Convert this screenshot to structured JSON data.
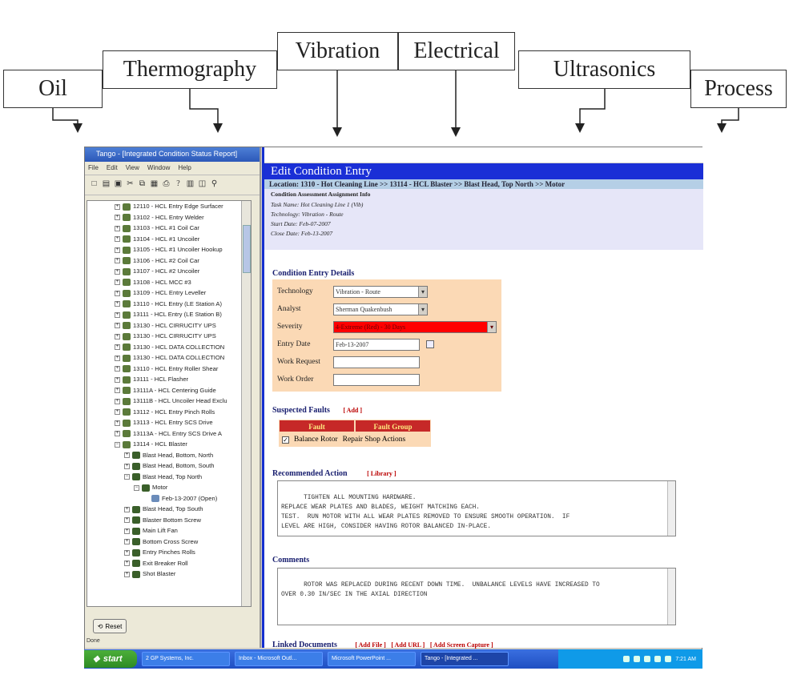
{
  "labels": {
    "oil": "Oil",
    "thermography": "Thermography",
    "vibration": "Vibration",
    "electrical": "Electrical",
    "ultrasonics": "Ultrasonics",
    "process": "Process"
  },
  "left_window": {
    "title": "Tango - [Integrated Condition Status Report]",
    "menu": [
      "File",
      "Edit",
      "View",
      "Window",
      "Help"
    ],
    "tree_items": [
      "12110 - HCL Entry Edge Surfacer",
      "13102 - HCL Entry Welder",
      "13103 - HCL #1 Coil Car",
      "13104 - HCL #1 Uncoiler",
      "13105 - HCL #1 Uncoiler Hookup",
      "13106 - HCL #2 Coil Car",
      "13107 - HCL #2 Uncoiler",
      "13108 - HCL MCC #3",
      "13109 - HCL Entry Leveller",
      "13110 - HCL Entry (LE Station A)",
      "13111 - HCL Entry (LE Station B)",
      "13130 - HCL CIRRUCITY UPS",
      "13130 - HCL CIRRUCITY UPS",
      "13130 - HCL DATA COLLECTION",
      "13130 - HCL DATA COLLECTION",
      "13110 - HCL Entry Roller Shear",
      "13111 - HCL Flasher",
      "13111A - HCL Centering Guide",
      "13111B - HCL Uncoiler Head Exclu",
      "13112 - HCL Entry Pinch Rolls",
      "13113 - HCL Entry SCS Drive",
      "13113A - HCL Entry SCS Drive A",
      "13114 - HCL Blaster",
      "Blast Head, Bottom, North",
      "Blast Head, Bottom, South",
      "Blast Head, Top North",
      "Motor",
      "Feb-13-2007 (Open)",
      "Blast Head, Top South",
      "Blaster Bottom Screw",
      "Main Lift Fan",
      "Bottom Cross Screw",
      "Entry Pinches Rolls",
      "Exit Breaker Roll",
      "Shot Blaster"
    ],
    "reset_label": "Reset",
    "status": "Done"
  },
  "edit": {
    "heading": "Edit Condition Entry",
    "location": "Location: 1310 - Hot Cleaning Line >> 13114 - HCL Blaster >> Blast Head, Top North >> Motor",
    "assignment_title": "Condition Assessment Assignment Info",
    "assignment_rows": [
      "Task Name: Hot Cleaning Line 1 (Vib)",
      "Technology: Vibration - Route",
      "Start Date: Feb-07-2007",
      "Close Date: Feb-13-2007"
    ],
    "details_title": "Condition Entry Details",
    "technology_label": "Technology",
    "technology_value": "Vibration - Route",
    "analyst_label": "Analyst",
    "analyst_value": "Sherman Quakenbush",
    "severity_label": "Severity",
    "severity_value": "4-Extreme (Red) - 30 Days",
    "entry_date_label": "Entry Date",
    "entry_date_value": "Feb-13-2007",
    "work_request_label": "Work Request",
    "work_order_label": "Work Order",
    "suspected_title": "Suspected Faults",
    "add_label": "[ Add ]",
    "fault_col": "Fault",
    "fault_group_col": "Fault Group",
    "fault_value": "Balance Rotor",
    "fault_group_value": "Repair Shop Actions",
    "recommended_title": "Recommended Action",
    "library_label": "[ Library ]",
    "recommended_text": "TIGHTEN ALL MOUNTING HARDWARE.\nREPLACE WEAR PLATES AND BLADES, WEIGHT MATCHING EACH.\nTEST.  RUN MOTOR WITH ALL WEAR PLATES REMOVED TO ENSURE SMOOTH OPERATION.  IF\nLEVEL ARE HIGH, CONSIDER HAVING ROTOR BALANCED IN-PLACE.",
    "comments_title": "Comments",
    "comments_text": "ROTOR WAS REPLACED DURING RECENT DOWN TIME.  UNBALANCE LEVELS HAVE INCREASED TO\nOVER 0.30 IN/SEC IN THE AXIAL DIRECTION",
    "linked_title": "Linked Documents",
    "linked_links": [
      "[ Add File ]",
      "[ Add URL ]",
      "[ Add Screen Capture ]"
    ]
  },
  "taskbar": {
    "start": "start",
    "buttons": [
      "2 GP Systems, Inc.",
      "Inbox - Microsoft Outl...",
      "Microsoft PowerPoint ...",
      "Tango - [Integrated ..."
    ],
    "time": "7:21 AM"
  }
}
